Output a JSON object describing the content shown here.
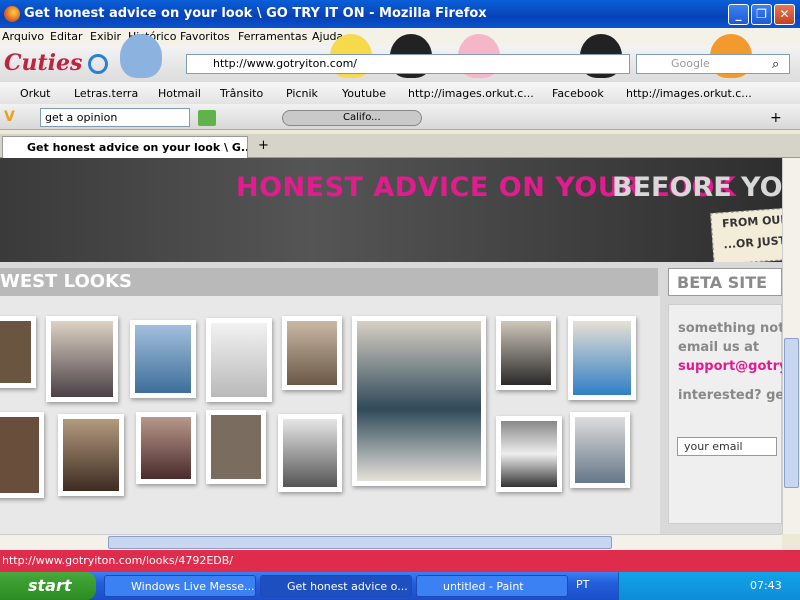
{
  "window": {
    "title": "Get honest advice on your look  \\  GO TRY IT ON - Mozilla Firefox"
  },
  "menu": [
    "Arquivo",
    "Editar",
    "Exibir",
    "Histórico",
    "Favoritos",
    "Ferramentas",
    "Ajuda"
  ],
  "nav": {
    "url": "http://www.gotryiton.com/",
    "search_placeholder": "Google",
    "theme_text": "Cuties"
  },
  "bookmarks": [
    "Orkut",
    "Letras.terra",
    "Hotmail",
    "Trânsito",
    "Picnik",
    "Youtube",
    "http://images.orkut.c...",
    "Facebook",
    "http://images.orkut.c..."
  ],
  "toolbar2": {
    "search_value": "get a opinion",
    "player_label": "Califo..."
  },
  "tab": {
    "label": "Get honest advice on your look  \\  G..."
  },
  "page": {
    "hero_pink": "HONEST ADVICE ON YOUR LOOK",
    "hero_grey": "BEFORE YOU G",
    "ticket_line1": "FROM OUR",
    "ticket_line2": "...OR JUST",
    "newest_looks": "WEST LOOKS",
    "beta_site": "BETA SITE",
    "side_text1": "something not pe",
    "side_text2": "email us at",
    "side_email": "support@gotryito",
    "side_text3": "interested? get u",
    "email_input_value": "your email"
  },
  "status": {
    "text": "http://www.gotryiton.com/looks/4792EDB/"
  },
  "taskbar": {
    "start": "start",
    "items": [
      "Windows Live Messe...",
      "Get honest advice o...",
      "untitled - Paint"
    ],
    "lang": "PT",
    "clock": "07:43"
  },
  "colors": {
    "accent_pink": "#e21b8f",
    "status_red": "#e02c4c",
    "xp_blue": "#245edb"
  }
}
